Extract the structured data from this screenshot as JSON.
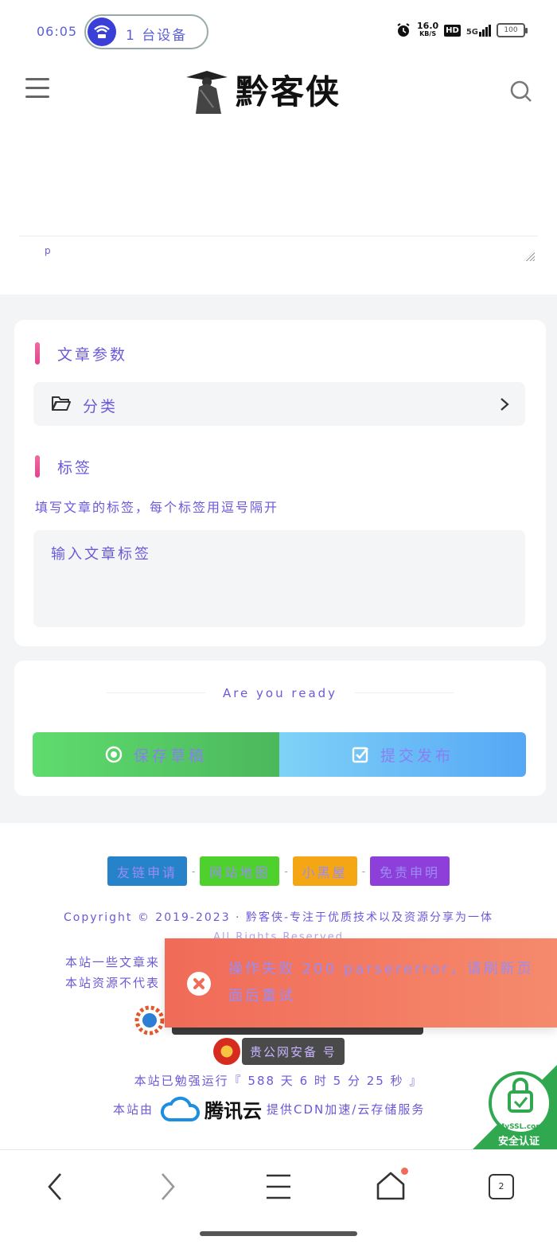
{
  "status_bar": {
    "time": "06:05",
    "hotspot_label": "1 台设备",
    "net_speed_value": "16.0",
    "net_speed_unit": "KB/S",
    "hd": "HD",
    "signal": "5G",
    "battery": "100"
  },
  "header": {
    "site_name": "黔客侠"
  },
  "editor": {
    "path_tag": "p"
  },
  "article_params": {
    "title": "文章参数",
    "category_label": "分类"
  },
  "tags": {
    "title": "标签",
    "hint": "填写文章的标签，每个标签用逗号隔开",
    "placeholder": "输入文章标签",
    "value": ""
  },
  "actions": {
    "ready_text": "Are you ready",
    "save_draft": "保存草稿",
    "submit_publish": "提交发布"
  },
  "footer": {
    "links": [
      "友链申请",
      "网站地图",
      "小黑屋",
      "免责申明"
    ],
    "copyright": "Copyright © 2019-2023 · 黔客侠-专注于优质技术以及资源分享为一体",
    "rights": "All Rights Reserved",
    "notice_line1": "本站一些文章来",
    "notice_line2": "本站资源不代表",
    "police_record": "贵公网安备 号",
    "uptime": "本站已勉强运行『 588 天 6 时 5 分 25 秒 』",
    "cdn_prefix": "本站由",
    "cdn_brand": "腾讯云",
    "cdn_suffix": "提供CDN加速/云存储服务",
    "ssl_badge_brand": "MySSL.com",
    "ssl_badge_text": "安全认证"
  },
  "toast": {
    "message": "操作失败 200 parsererror，请刷新页面后重试"
  },
  "bottom_nav": {
    "tab_count": "2"
  },
  "colors": {
    "accent_text": "#6a5ad8",
    "save_green": "#5fdc6e",
    "submit_blue": "#55a7f5",
    "toast_red": "#f06b58",
    "section_bar_pink": "#e0458f"
  }
}
